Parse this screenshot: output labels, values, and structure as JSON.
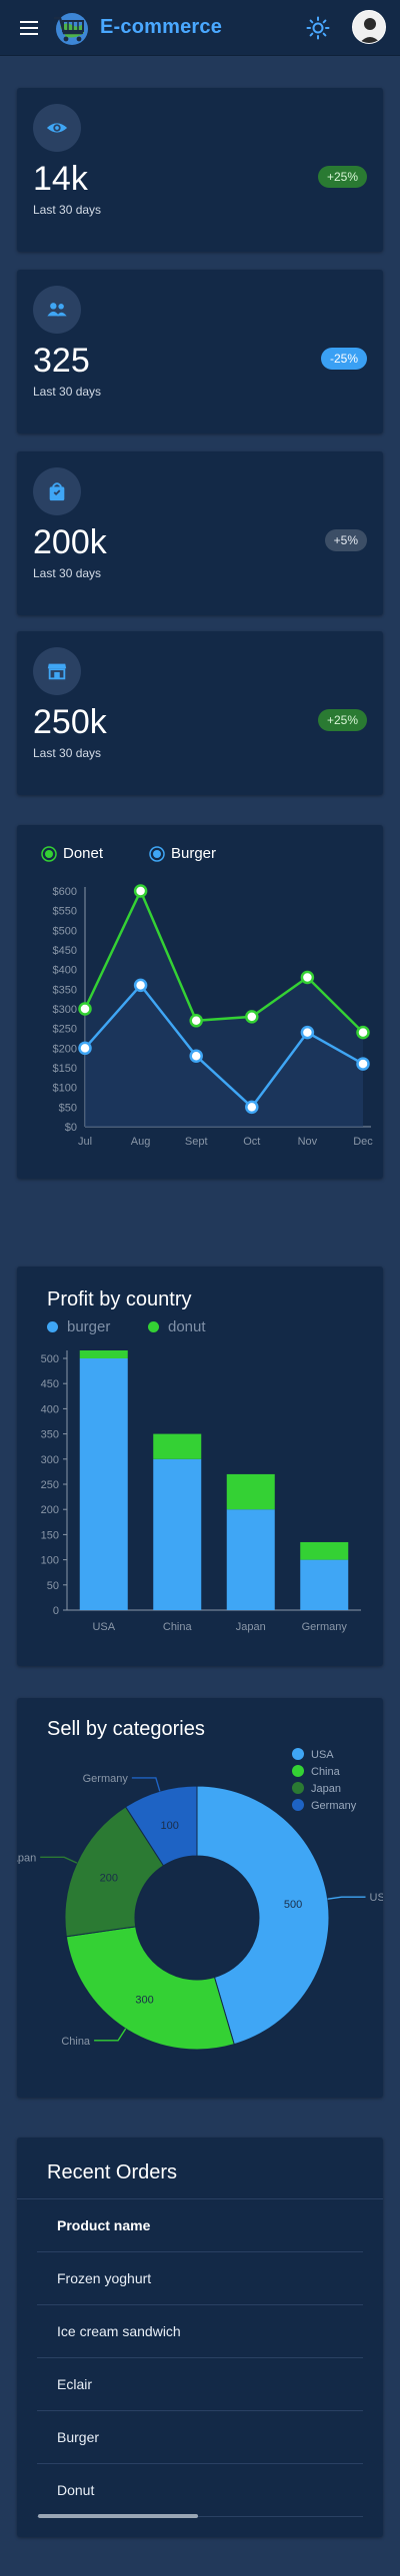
{
  "header": {
    "title": "E-commerce",
    "menu_icon": "hamburger-menu-icon",
    "logo_icon": "shopping-cart-globe-logo",
    "theme_icon": "sun-icon",
    "avatar_icon": "user-avatar"
  },
  "stats": [
    {
      "value": "14k",
      "caption": "Last 30 days",
      "badge": "+25%",
      "icon": "eye-icon",
      "badge_color": "#2a7a32"
    },
    {
      "value": "325",
      "caption": "Last 30 days",
      "badge": "-25%",
      "icon": "users-icon",
      "badge_color": "#3aa0f4"
    },
    {
      "value": "200k",
      "caption": "Last 30 days",
      "badge": "+5%",
      "icon": "shopping-bag-icon",
      "badge_color": "#3c4e66"
    },
    {
      "value": "250k",
      "caption": "Last 30 days",
      "badge": "+25%",
      "icon": "store-icon",
      "badge_color": "#2a7a32"
    }
  ],
  "colors": {
    "accent": "#4aa8ff",
    "green": "#34d134",
    "blue": "#3fa6f5",
    "dark_green": "#2b7a33",
    "dark_blue": "#1e63c4"
  },
  "line_chart": {
    "chart_data": {
      "type": "line",
      "x": [
        "Jul",
        "Aug",
        "Sept",
        "Oct",
        "Nov",
        "Dec"
      ],
      "series": [
        {
          "name": "Donet",
          "values": [
            300,
            600,
            270,
            280,
            380,
            240
          ]
        },
        {
          "name": "Burger",
          "values": [
            200,
            360,
            180,
            50,
            240,
            160
          ]
        }
      ],
      "y_ticks": [
        "$0",
        "$50",
        "$100",
        "$150",
        "$200",
        "$250",
        "$300",
        "$350",
        "$400",
        "$450",
        "$500",
        "$550",
        "$600"
      ],
      "ylim": [
        0,
        620
      ],
      "legend": "top-left",
      "area_fill": true
    }
  },
  "bar_chart": {
    "title": "Profit by country",
    "chart_data": {
      "type": "bar",
      "stacked": true,
      "categories": [
        "USA",
        "China",
        "Japan",
        "Germany"
      ],
      "series": [
        {
          "name": "burger",
          "values": [
            500,
            300,
            200,
            100
          ]
        },
        {
          "name": "donut",
          "values": [
            30,
            50,
            70,
            35
          ]
        }
      ],
      "y_ticks": [
        "0",
        "50",
        "100",
        "150",
        "200",
        "250",
        "300",
        "350",
        "400",
        "450",
        "500"
      ],
      "ylim": [
        0,
        540
      ],
      "legend": "top-left"
    }
  },
  "pie_chart": {
    "title": "Sell by categories",
    "chart_data": {
      "type": "pie",
      "donut": true,
      "categories": [
        "USA",
        "China",
        "Japan",
        "Germany"
      ],
      "values": [
        500,
        300,
        200,
        100
      ],
      "colors": [
        "#3fa6f5",
        "#34d134",
        "#2b7a33",
        "#1e63c4"
      ],
      "legend": "top-right"
    },
    "callouts": [
      "US",
      "China",
      "Japan",
      "Germany"
    ]
  },
  "orders": {
    "title": "Recent Orders",
    "column_header": "Product name",
    "rows": [
      "Frozen yoghurt",
      "Ice cream sandwich",
      "Eclair",
      "Burger",
      "Donut"
    ]
  }
}
